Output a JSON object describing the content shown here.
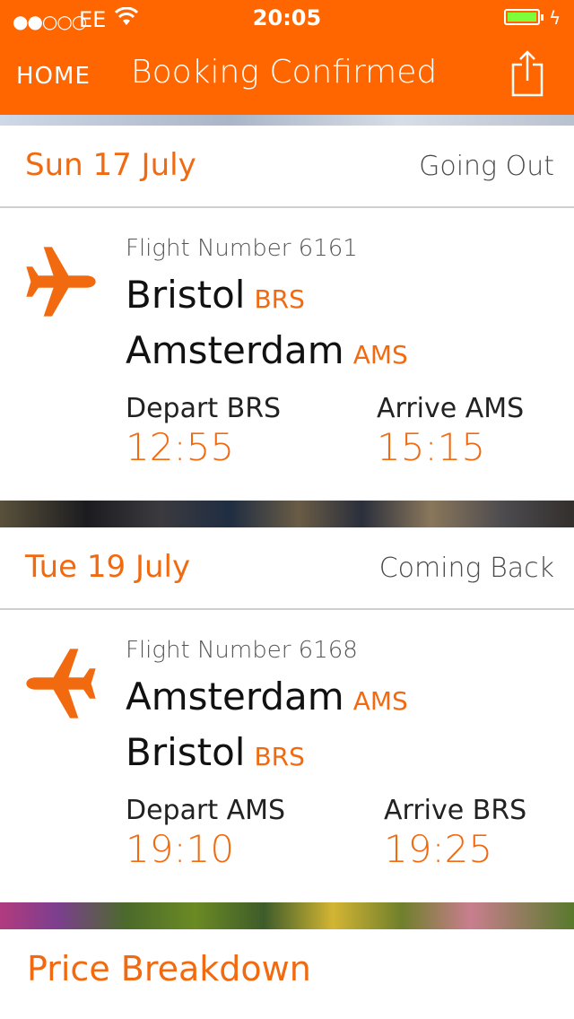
{
  "status_bar": {
    "signal": "●●○○○",
    "carrier": "EE",
    "time": "20:05"
  },
  "nav": {
    "home_label": "HOME",
    "title": "Booking Confirmed"
  },
  "outbound": {
    "date": "Sun 17 July",
    "direction": "Going Out",
    "flight_number": "Flight Number 6161",
    "from_city": "Bristol",
    "from_code": "BRS",
    "to_city": "Amsterdam",
    "to_code": "AMS",
    "depart_label": "Depart BRS",
    "depart_time": "12:55",
    "arrive_label": "Arrive AMS",
    "arrive_time": "15:15"
  },
  "return": {
    "date": "Tue 19 July",
    "direction": "Coming Back",
    "flight_number": "Flight Number 6168",
    "from_city": "Amsterdam",
    "from_code": "AMS",
    "to_city": "Bristol",
    "to_code": "BRS",
    "depart_label": "Depart AMS",
    "depart_time": "19:10",
    "arrive_label": "Arrive BRS",
    "arrive_time": "19:25"
  },
  "price_section": {
    "title": "Price Breakdown"
  },
  "colors": {
    "brand_orange": "#ff6600",
    "accent_text": "#f26a10"
  },
  "icons": {
    "share": "share-icon",
    "plane": "airplane-icon",
    "wifi": "wifi-icon",
    "battery": "battery-icon"
  }
}
